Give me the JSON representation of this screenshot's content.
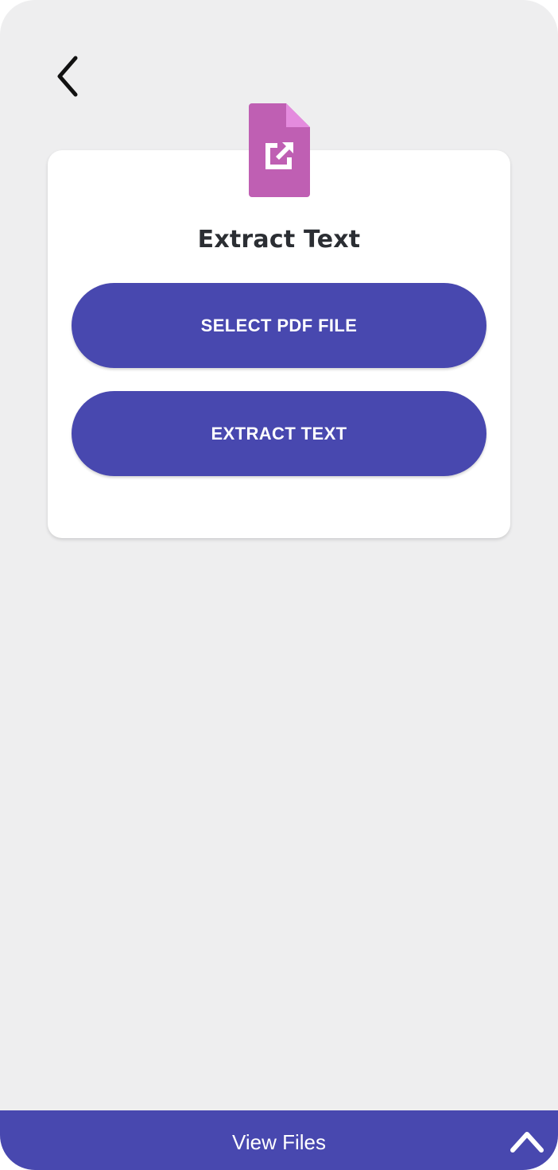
{
  "header": {
    "back_icon": "chevron-left-icon"
  },
  "card": {
    "icon": "pdf-export-file-icon",
    "title": "Extract Text",
    "select_button_label": "SELECT PDF FILE",
    "extract_button_label": "EXTRACT TEXT"
  },
  "bottom_bar": {
    "label": "View Files",
    "toggle_icon": "chevron-up-icon"
  },
  "colors": {
    "background": "#eeeeef",
    "card": "#ffffff",
    "accent": "#4848af",
    "file_icon": "#bf5fb3",
    "file_icon_fold": "#e48bde",
    "title_text": "#2b2e33"
  }
}
